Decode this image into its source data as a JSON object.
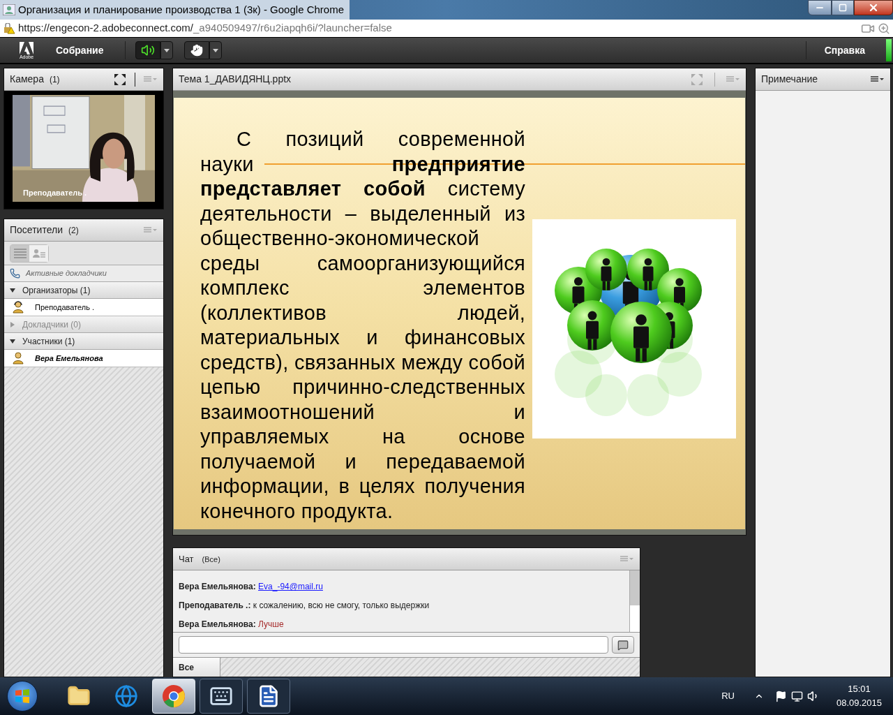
{
  "window": {
    "title": "Организация и планирование производства 1 (3к) - Google Chrome",
    "url_host": "https://engecon-2.adobeconnect.com/",
    "url_path": "_a940509497/r6u2iapqh6i/?launcher=false"
  },
  "toolbar": {
    "logo_text": "Adobe",
    "meeting_menu": "Собрание",
    "speaker_on": true,
    "help": "Справка"
  },
  "camera": {
    "title": "Камера",
    "count": "(1)",
    "caption": "Преподаватель ."
  },
  "attendees": {
    "title": "Посетители",
    "count": "(2)",
    "view_list_selected": true,
    "active_speakers": "Активные докладчики",
    "groups": [
      {
        "label": "Организаторы (1)",
        "expanded": true,
        "members": [
          {
            "name": "Преподаватель .",
            "kind": "host"
          }
        ]
      },
      {
        "label": "Докладчики (0)",
        "expanded": false
      },
      {
        "label": "Участники (1)",
        "expanded": true,
        "members": [
          {
            "name": "Вера Емельянова",
            "kind": "participant"
          }
        ]
      }
    ]
  },
  "share": {
    "title": "Тема 1_ДАВИДЯНЦ.pptx",
    "slide_text": "С позиций современной науки **предприятие представляет собой** систему деятельности – выделенный из общественно-экономической среды самоорганизующийся комплекс элементов (коллективов людей, материальных и финансовых средств), связанных между собой цепью причинно-следственных взаимоотношений и управляемых на основе получаемой и передаваемой информации, в целях получения конечного продукта."
  },
  "note": {
    "title": "Примечание"
  },
  "chat": {
    "title": "Чат",
    "scope": "(Все)",
    "messages": [
      {
        "sender": "Вера Емельянова:",
        "text": "Eva_-94@mail.ru",
        "kind": "link"
      },
      {
        "sender": "Преподаватель .:",
        "text": "к сожалению, всю не смогу, только выдержки",
        "kind": "plain"
      },
      {
        "sender": "Вера Емельянова:",
        "text": "Лучше",
        "kind": "colored",
        "color": "#a52a2a"
      }
    ],
    "tab": "Все"
  },
  "taskbar": {
    "apps": [
      {
        "kind": "folder",
        "selected": false
      },
      {
        "kind": "browser",
        "selected": false
      },
      {
        "kind": "chrome",
        "selected": true
      },
      {
        "kind": "keyboard",
        "selected": false
      },
      {
        "kind": "word",
        "selected": false
      }
    ],
    "language": "RU",
    "time": "15:01",
    "date": "08.09.2015"
  }
}
